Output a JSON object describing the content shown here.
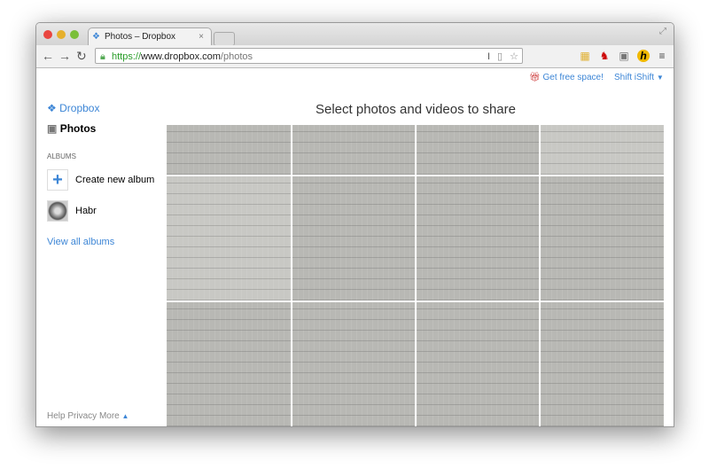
{
  "browser": {
    "tab_title": "Photos – Dropbox",
    "url_scheme": "https://",
    "url_host": "www.dropbox.com",
    "url_path": "/photos"
  },
  "header": {
    "free_space": "Get free space!",
    "user": "Shift iShift"
  },
  "sidebar": {
    "brand": "Dropbox",
    "photos": "Photos",
    "albums_heading": "ALBUMS",
    "create_album": "Create new album",
    "album": "Habr",
    "view_all": "View all albums",
    "footer": {
      "help": "Help",
      "privacy": "Privacy",
      "more": "More"
    }
  },
  "main": {
    "title": "Select photos and videos to share"
  },
  "colors": {
    "link": "#3d86d6"
  }
}
